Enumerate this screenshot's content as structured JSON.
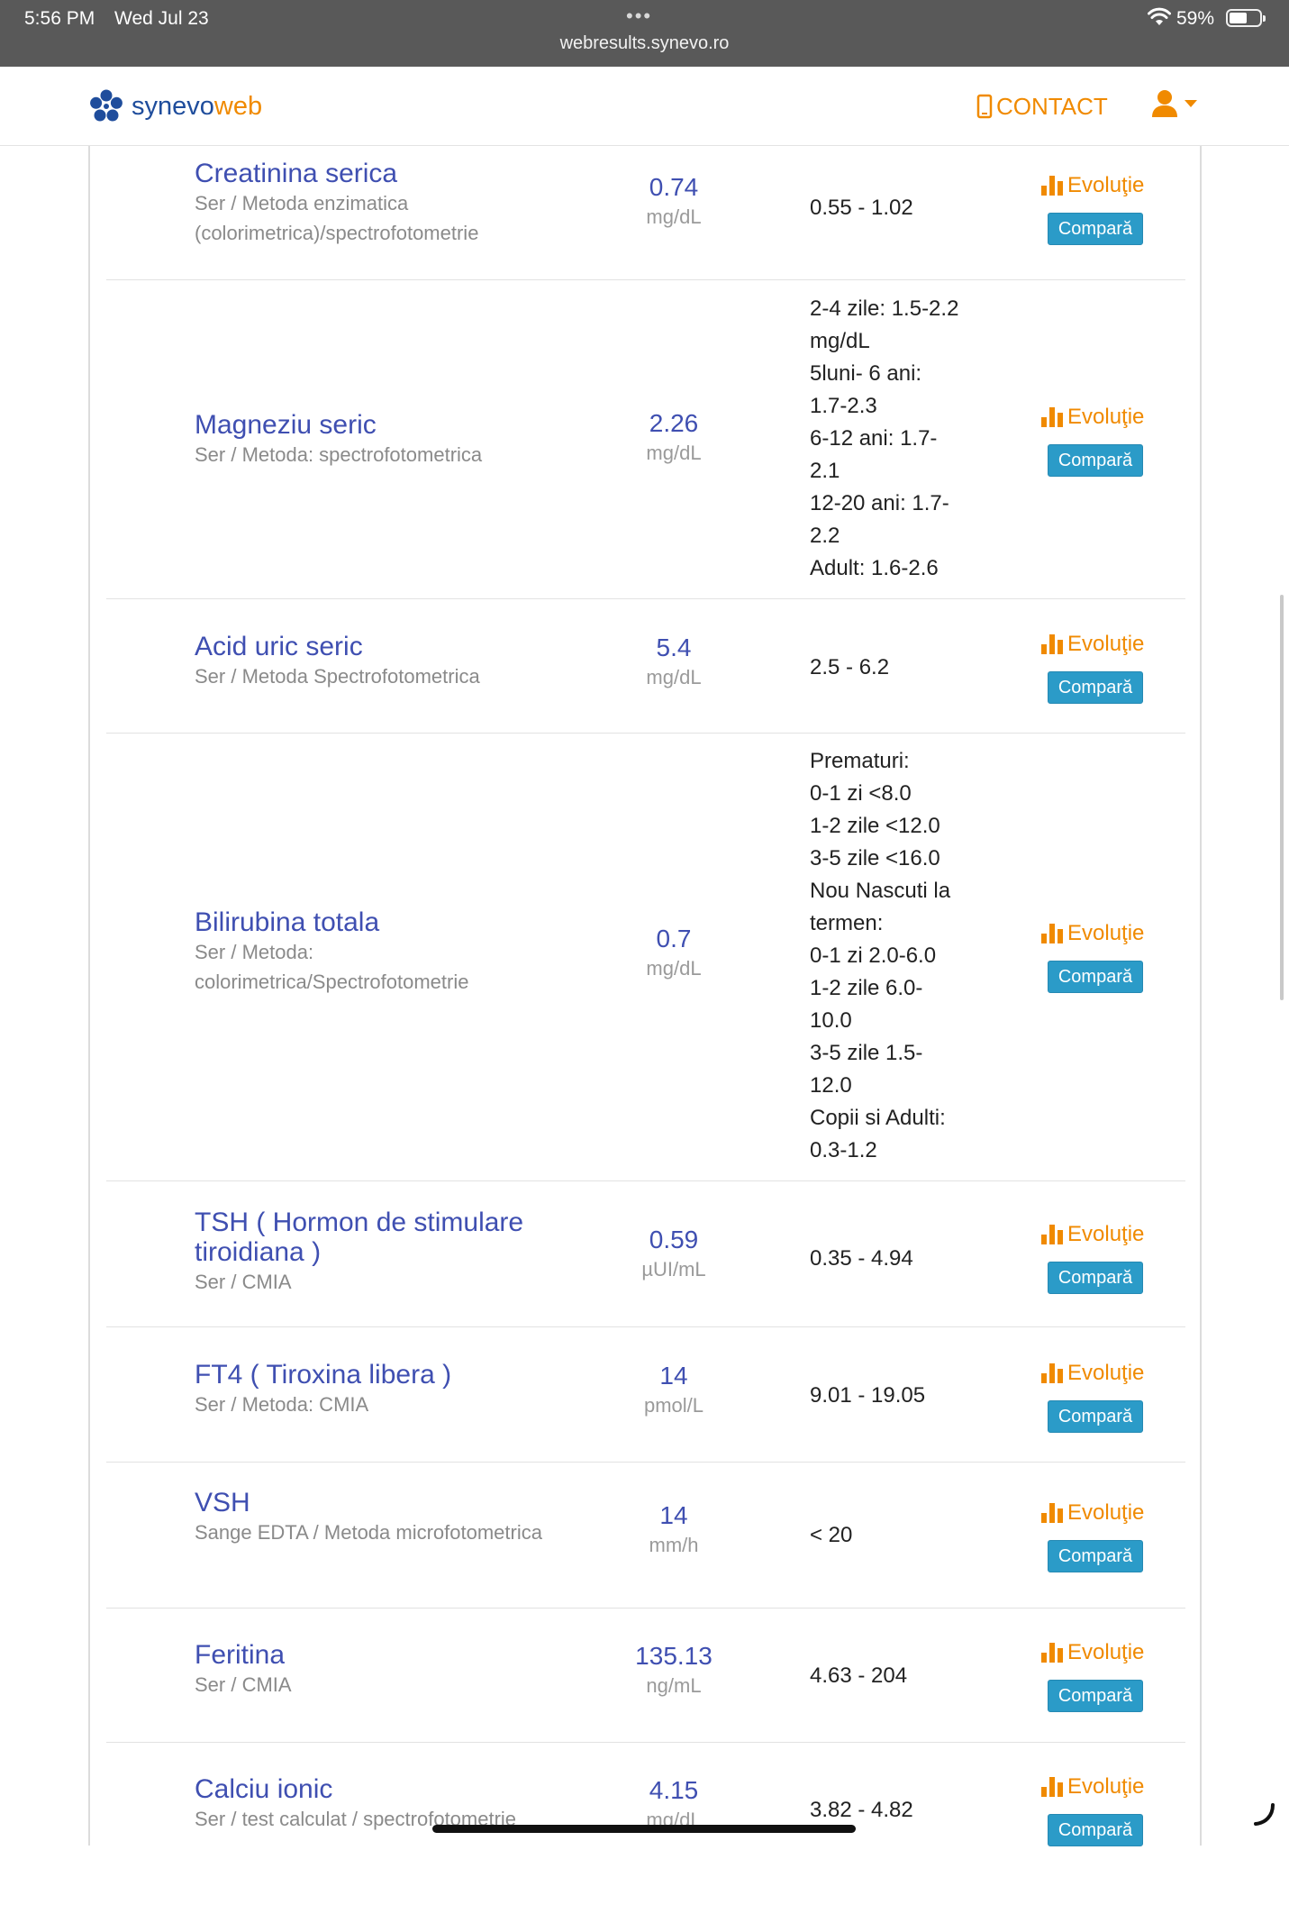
{
  "status_bar": {
    "time": "5:56 PM",
    "date": "Wed Jul 23",
    "url": "webresults.synevo.ro",
    "battery_pct": "59%"
  },
  "header": {
    "brand_part1": "synevo",
    "brand_part2": "web",
    "contact_label": "CONTACT"
  },
  "actions": {
    "evolutie_label": "Evoluţie",
    "compara_label": "Compară"
  },
  "colors": {
    "accent_orange": "#f08a00",
    "link_blue": "#3f4fb1",
    "button_blue": "#2b9bc8",
    "browser_bar": "#595959"
  },
  "results": [
    {
      "title": "Creatinina serica",
      "subtitle": "Ser / Metoda enzimatica (colorimetrica)/spectrofotometrie",
      "value": "0.74",
      "unit": "mg/dL",
      "range": "0.55 - 1.02"
    },
    {
      "title": "Magneziu seric",
      "subtitle": "Ser / Metoda: spectrofotometrica",
      "value": "2.26",
      "unit": "mg/dL",
      "range": "2-4 zile: 1.5-2.2\nmg/dL\n5luni- 6 ani:\n1.7-2.3\n6-12 ani: 1.7-\n2.1\n12-20 ani: 1.7-\n2.2\nAdult: 1.6-2.6"
    },
    {
      "title": "Acid uric seric",
      "subtitle": "Ser / Metoda Spectrofotometrica",
      "value": "5.4",
      "unit": "mg/dL",
      "range": "2.5 - 6.2"
    },
    {
      "title": "Bilirubina totala",
      "subtitle": "Ser / Metoda: colorimetrica/Spectrofotometrie",
      "value": "0.7",
      "unit": "mg/dL",
      "range": "Prematuri:\n0-1 zi <8.0\n1-2 zile <12.0\n3-5 zile <16.0\nNou Nascuti la\ntermen:\n0-1 zi 2.0-6.0\n1-2 zile 6.0-\n10.0\n3-5 zile 1.5-\n12.0\nCopii si Adulti:\n0.3-1.2"
    },
    {
      "title": "TSH ( Hormon de stimulare tiroidiana )",
      "subtitle": "Ser / CMIA",
      "value": "0.59",
      "unit": "µUI/mL",
      "range": "0.35 - 4.94"
    },
    {
      "title": "FT4 ( Tiroxina libera )",
      "subtitle": "Ser / Metoda: CMIA",
      "value": "14",
      "unit": "pmol/L",
      "range": "9.01 - 19.05"
    },
    {
      "title": "VSH",
      "subtitle": "Sange EDTA / Metoda microfotometrica",
      "value": "14",
      "unit": "mm/h",
      "range": "< 20"
    },
    {
      "title": "Feritina",
      "subtitle": "Ser / CMIA",
      "value": "135.13",
      "unit": "ng/mL",
      "range": "4.63 - 204"
    },
    {
      "title": "Calciu ionic",
      "subtitle": "Ser / test calculat / spectrofotometrie",
      "value": "4.15",
      "unit": "mg/dL",
      "range": "3.82 - 4.82"
    }
  ]
}
